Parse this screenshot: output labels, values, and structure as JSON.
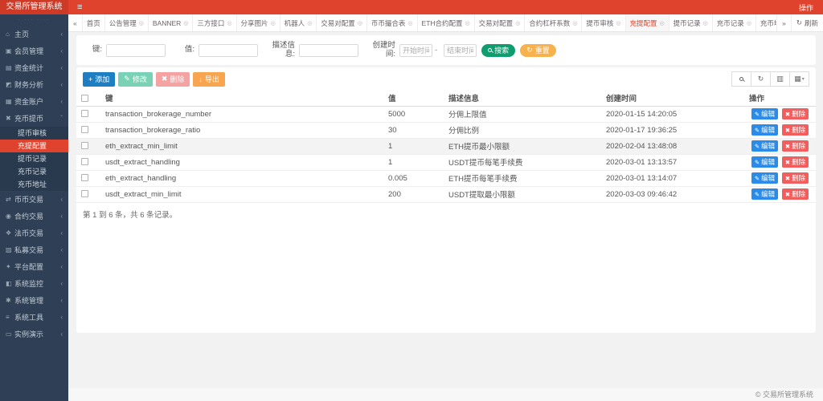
{
  "app": {
    "title": "交易所管理系统",
    "action_label": "操作"
  },
  "icons": {
    "menu": "≡",
    "home": "⌂",
    "member": "▣",
    "stats": "▤",
    "finance": "◩",
    "account": "▦",
    "coin": "✖",
    "trade": "⇄",
    "contract": "◉",
    "fiat": "❖",
    "private": "▨",
    "platform": "✦",
    "monitor": "◧",
    "system": "✱",
    "tools": "≡",
    "demo": "▭",
    "chevron_left": "‹",
    "chevron_down": "ˇ",
    "collapse": "«",
    "forward": "»",
    "refresh": "↻",
    "close": "◎",
    "close_x": "✖",
    "add": "+",
    "edit": "✎",
    "export": "↓",
    "columns": "▥",
    "grid": "▦",
    "caret": "▾"
  },
  "colors": {
    "accent_red": "#e0432d",
    "sidebar_bg": "#2f4056",
    "btn_add": "#1d7fc2",
    "btn_modify": "#79d2b5",
    "btn_delete": "#f5a2a2",
    "btn_export": "#f7a54f",
    "btn_search": "#0e9d6e",
    "btn_reset": "#f7b14d",
    "btn_edit": "#2a8ce8",
    "btn_del": "#f25d5d"
  },
  "sidebar": {
    "user_hint": "· ···  ····",
    "items": [
      {
        "label": "主页"
      },
      {
        "label": "会员管理"
      },
      {
        "label": "资金统计"
      },
      {
        "label": "财务分析"
      },
      {
        "label": "资金账户"
      },
      {
        "label": "充币提币"
      },
      {
        "label": "币币交易"
      },
      {
        "label": "合约交易"
      },
      {
        "label": "法币交易"
      },
      {
        "label": "私募交易"
      },
      {
        "label": "平台配置"
      },
      {
        "label": "系统监控"
      },
      {
        "label": "系统管理"
      },
      {
        "label": "系统工具"
      },
      {
        "label": "实例演示"
      }
    ],
    "submenu": [
      "提币审核",
      "充提配置",
      "提币记录",
      "充币记录",
      "充币地址"
    ]
  },
  "tabs": {
    "items": [
      {
        "label": "首页"
      },
      {
        "label": "公告管理"
      },
      {
        "label": "BANNER"
      },
      {
        "label": "三方接口"
      },
      {
        "label": "分享图片"
      },
      {
        "label": "机器人"
      },
      {
        "label": "交易对配置"
      },
      {
        "label": "币币撮合表"
      },
      {
        "label": "ETH合约配置"
      },
      {
        "label": "交易对配置"
      },
      {
        "label": "合约杠杆系数"
      },
      {
        "label": "提币审核"
      },
      {
        "label": "充提配置"
      },
      {
        "label": "提币记录"
      },
      {
        "label": "充币记录"
      },
      {
        "label": "充币地址"
      }
    ],
    "refresh_label": "刷新"
  },
  "filter": {
    "key_label": "键:",
    "value_label": "值:",
    "desc_label": "描述信息:",
    "time_label": "创建时间:",
    "start_placeholder": "开始时间",
    "end_placeholder": "结束时间",
    "separator": "-",
    "search_label": "搜索",
    "reset_label": "重置"
  },
  "toolbar": {
    "add": "添加",
    "modify": "修改",
    "delete": "删除",
    "export": "导出"
  },
  "table": {
    "columns": [
      "键",
      "值",
      "描述信息",
      "创建时间",
      "操作"
    ],
    "rows": [
      {
        "key": "transaction_brokerage_number",
        "value": "5000",
        "desc": "分佣上限值",
        "created": "2020-01-15 14:20:05"
      },
      {
        "key": "transaction_brokerage_ratio",
        "value": "30",
        "desc": "分佣比例",
        "created": "2020-01-17 19:36:25"
      },
      {
        "key": "eth_extract_min_limit",
        "value": "1",
        "desc": "ETH提币最小限额",
        "created": "2020-02-04 13:48:08"
      },
      {
        "key": "usdt_extract_handling",
        "value": "1",
        "desc": "USDT提币每笔手续费",
        "created": "2020-03-01 13:13:57"
      },
      {
        "key": "eth_extract_handling",
        "value": "0.005",
        "desc": "ETH提币每笔手续费",
        "created": "2020-03-01 13:14:07"
      },
      {
        "key": "usdt_extract_min_limit",
        "value": "200",
        "desc": "USDT提取最小限额",
        "created": "2020-03-03 09:46:42"
      }
    ],
    "row_actions": {
      "edit": "编辑",
      "delete": "删除"
    },
    "summary": "第 1 到 6 条，共 6 条记录。"
  },
  "footer": {
    "copyright": "© 交易所管理系统"
  }
}
